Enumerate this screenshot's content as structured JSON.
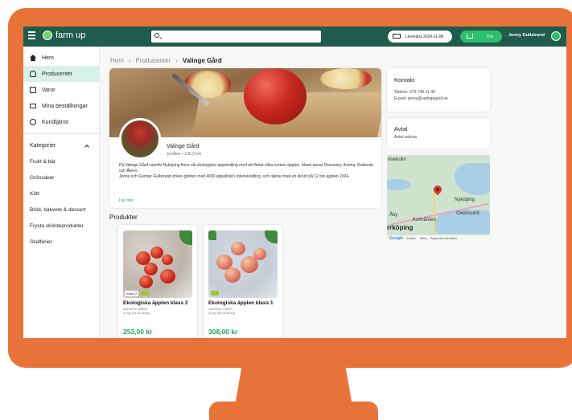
{
  "colors": {
    "monitor": "#e8733a",
    "topbar": "#1f5c4b",
    "accent": "#2dbf6c",
    "price": "#1aa860"
  },
  "topbar": {
    "logo_text": "farm up",
    "search_placeholder": "",
    "delivery_label": "Leverans 2024-11-08",
    "cart_amount": "0 kr",
    "user_name": "Jenny Gullstrand"
  },
  "sidebar": {
    "nav": [
      {
        "label": "Hem",
        "icon": "home-icon"
      },
      {
        "label": "Producenter",
        "icon": "people-icon"
      },
      {
        "label": "Varor",
        "icon": "box-icon"
      },
      {
        "label": "Mina beställningar",
        "icon": "truck-icon"
      },
      {
        "label": "Kundtjänst",
        "icon": "help-icon"
      }
    ],
    "categories_heading": "Kategorier",
    "categories": [
      "Frukt & bär",
      "Grönsaker",
      "Kött",
      "Bröd, bakverk & dessert",
      "Frysta skördeprodukter",
      "Skafferiet"
    ]
  },
  "breadcrumb": {
    "items": [
      "Hem",
      "Producenter"
    ],
    "current": "Valinge Gård"
  },
  "producer": {
    "name": "Valinge Gård",
    "location": "Jonåker • 130.3 km",
    "description_1": "På Valinge Gård utanför Nyköping finns vår ekologiska äppelodling med ett flertal olika sorters äpplen, bland annat Discovery, Aroma, Rubinola och Åkero.",
    "description_2": "Jenny och Gunnar Gullstrand driver gården med 4000 äppelträd i intensivodling, och räknar med en skörd på 12 ton äpplen 2024.",
    "read_more": "Läs mer"
  },
  "contact": {
    "title": "Kontakt",
    "phone": "Telefon: 070-740 11 40",
    "email": "E-post: jenny@valingegard.se"
  },
  "agreement": {
    "title": "Avtal",
    "status": "Avtal saknas"
  },
  "map": {
    "labels": [
      "rineholm",
      "Nyköping",
      "Oxelösund",
      "Åby",
      "Kolmården",
      "rrköping"
    ],
    "footer": [
      "Google",
      "Kortkort",
      "Villkor",
      "Rapportera ett kartfel"
    ]
  },
  "products": {
    "heading": "Produkter",
    "items": [
      {
        "name": "Ekologiska äpplen klass 2",
        "vendor": "VALINGE GÅRD",
        "weight": "11 kg (23,00 kr/kg)",
        "price": "253,00 kr",
        "class_badge": "Klass 2"
      },
      {
        "name": "Ekologiska äpplen klass 1",
        "vendor": "VALINGE GÅRD",
        "weight": "11 kg (28,00 kr/kg)",
        "price": "308,00 kr",
        "class_badge": ""
      }
    ]
  }
}
